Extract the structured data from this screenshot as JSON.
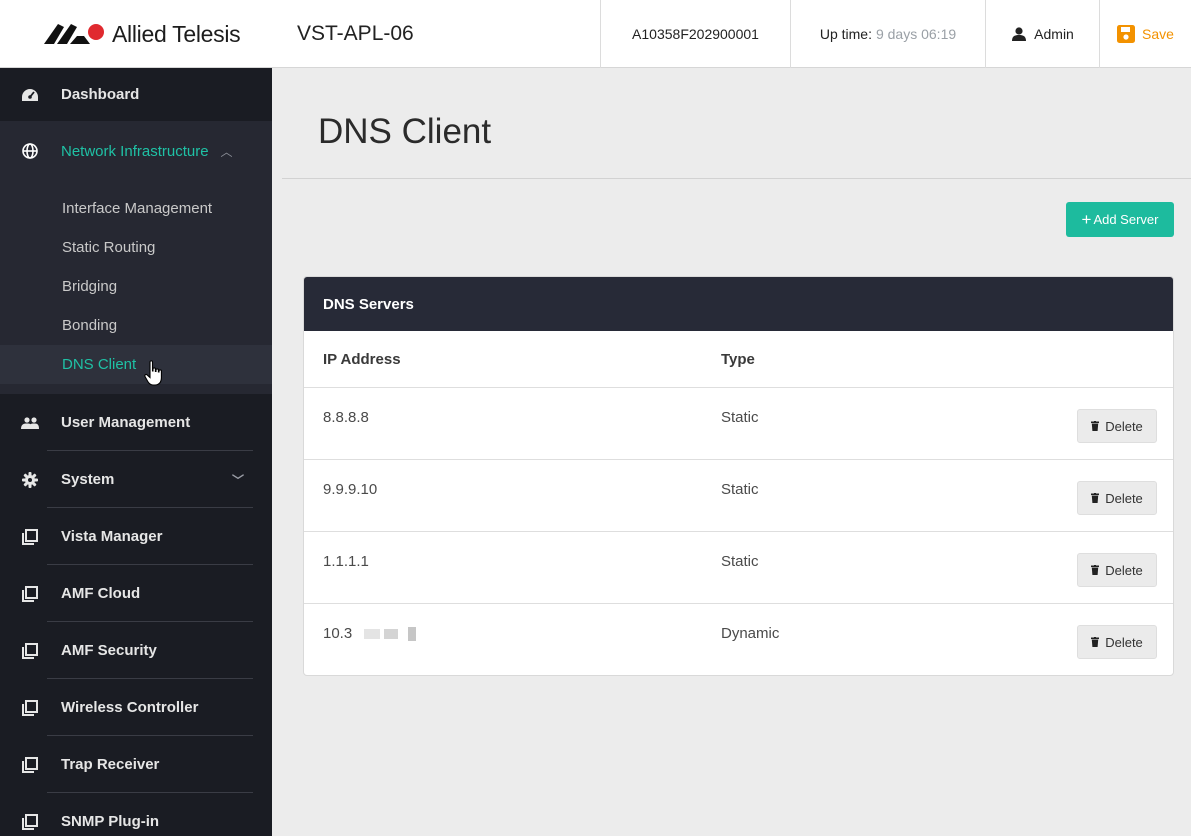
{
  "topbar": {
    "brand": "Allied Telesis",
    "device_name": "VST-APL-06",
    "serial": "A10358F202900001",
    "uptime_label": "Up time:",
    "uptime_value": "9 days 06:19",
    "user": "Admin",
    "save_label": "Save",
    "accent_color": "#f39200"
  },
  "sidebar": {
    "items": [
      {
        "label": "Dashboard",
        "icon": "dashboard-gauge-icon"
      },
      {
        "label": "Network Infrastructure",
        "icon": "globe-icon",
        "expanded": true
      },
      {
        "label": "User Management",
        "icon": "users-icon"
      },
      {
        "label": "System",
        "icon": "gear-icon"
      },
      {
        "label": "Vista Manager",
        "icon": "window-icon"
      },
      {
        "label": "AMF Cloud",
        "icon": "window-icon"
      },
      {
        "label": "AMF Security",
        "icon": "window-icon"
      },
      {
        "label": "Wireless Controller",
        "icon": "window-icon"
      },
      {
        "label": "Trap Receiver",
        "icon": "window-icon"
      },
      {
        "label": "SNMP Plug-in",
        "icon": "window-icon"
      }
    ],
    "sub_items": [
      {
        "label": "Interface Management"
      },
      {
        "label": "Static Routing"
      },
      {
        "label": "Bridging"
      },
      {
        "label": "Bonding"
      },
      {
        "label": "DNS Client",
        "active": true
      }
    ],
    "accent_color": "#1fc1a5"
  },
  "main": {
    "title": "DNS Client",
    "add_button_label": "Add Server",
    "table": {
      "title": "DNS Servers",
      "columns": [
        "IP Address",
        "Type"
      ],
      "rows": [
        {
          "ip": "8.8.8.8",
          "type": "Static"
        },
        {
          "ip": "9.9.9.10",
          "type": "Static"
        },
        {
          "ip": "1.1.1.1",
          "type": "Static"
        },
        {
          "ip": "10.3",
          "type": "Dynamic",
          "redacted": true
        }
      ],
      "delete_label": "Delete"
    }
  }
}
